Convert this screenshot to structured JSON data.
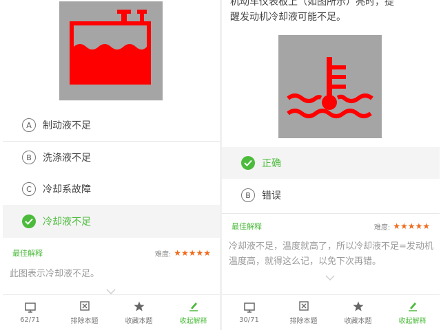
{
  "left": {
    "options": [
      {
        "key": "A",
        "text": "制动液不足",
        "selected": false
      },
      {
        "key": "B",
        "text": "洗涤液不足",
        "selected": false
      },
      {
        "key": "C",
        "text": "冷却系故障",
        "selected": false
      },
      {
        "key": "",
        "text": "冷却液不足",
        "selected": true
      }
    ],
    "explain_title": "最佳解释",
    "difficulty_label": "难度:",
    "stars": "★★★★★",
    "explain_text": "此图表示冷却液不足。",
    "toolbar": [
      {
        "label": "62/71",
        "icon": "monitor-icon"
      },
      {
        "label": "排除本题",
        "icon": "close-box-icon"
      },
      {
        "label": "收藏本题",
        "icon": "star-icon"
      },
      {
        "label": "收起解释",
        "icon": "pencil-icon"
      }
    ]
  },
  "right": {
    "question_top": "机动车仪表板上（如图所示）亮时，提",
    "question_bottom": "醒发动机冷却液可能不足。",
    "options": [
      {
        "key": "",
        "text": "正确",
        "selected": true
      },
      {
        "key": "B",
        "text": "错误",
        "selected": false
      }
    ],
    "explain_title": "最佳解释",
    "difficulty_label": "难度:",
    "stars": "★★★★★",
    "explain_text": "冷却液不足，温度就高了，所以冷却液不足=发动机温度高，就得这么记，以免下次再错。",
    "toolbar": [
      {
        "label": "30/71",
        "icon": "monitor-icon"
      },
      {
        "label": "排除本题",
        "icon": "close-box-icon"
      },
      {
        "label": "收藏本题",
        "icon": "star-icon"
      },
      {
        "label": "收起解释",
        "icon": "pencil-icon"
      }
    ]
  },
  "colors": {
    "accent": "#4cbb3c",
    "warning_red": "#ff0000",
    "stars": "#f06a1a",
    "image_bg": "#a5a5a5"
  }
}
